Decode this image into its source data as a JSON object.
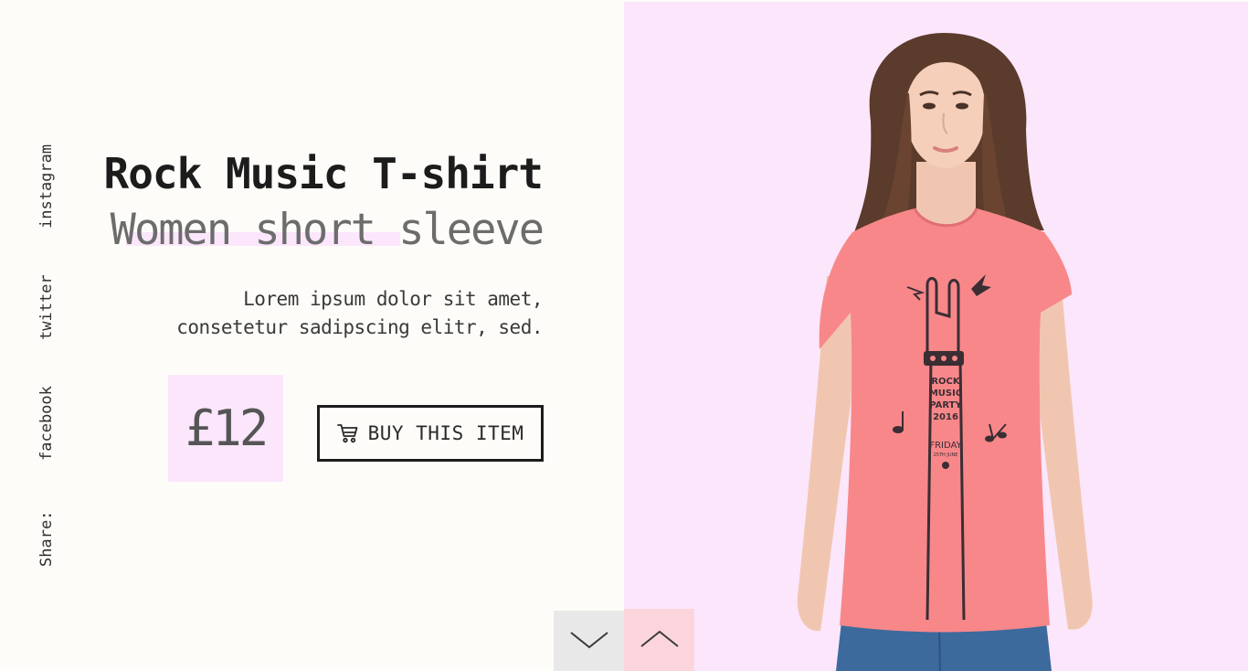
{
  "share": {
    "label": "Share:",
    "links": {
      "facebook": "facebook",
      "twitter": "twitter",
      "instagram": "instagram"
    }
  },
  "product": {
    "title": "Rock Music T-shirt",
    "subtitle": "Women short sleeve",
    "description_line1": "Lorem ipsum dolor sit amet,",
    "description_line2": "consetetur sadipscing elitr, sed.",
    "price": "£12"
  },
  "buy_button": {
    "label": "BUY THIS ITEM",
    "icon": "cart-icon"
  },
  "navigation": {
    "down_icon": "chevron-down-icon",
    "up_icon": "chevron-up-icon"
  },
  "shirt_print": {
    "line1": "ROCK",
    "line2": "MUSIC",
    "line3": "PARTY",
    "line4": "2016",
    "day": "FRIDAY",
    "date": "25TH JUNE"
  },
  "colors": {
    "left_background": "#fdfcf9",
    "right_background": "#fbe6fb",
    "accent_pink": "#fbe6fb",
    "shirt": "#f8878a",
    "nav_down_bg": "#e8e8e8",
    "nav_up_bg": "#fcd5dc",
    "text_dark": "#1c1c1c"
  }
}
